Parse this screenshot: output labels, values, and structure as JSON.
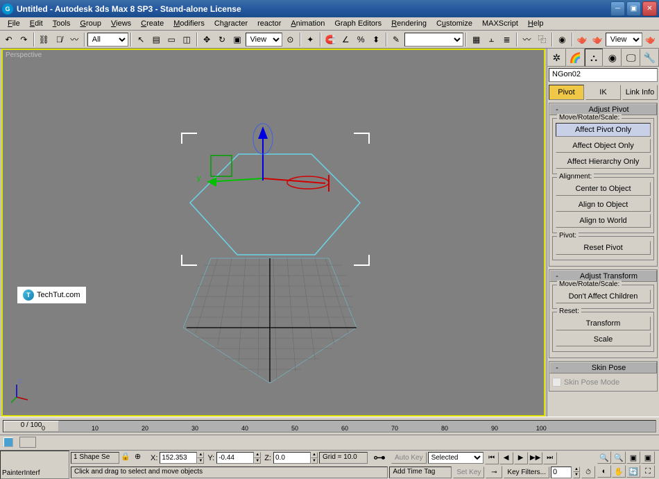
{
  "window": {
    "title": "Untitled - Autodesk 3ds Max 8 SP3  - Stand-alone License"
  },
  "menus": [
    "File",
    "Edit",
    "Tools",
    "Group",
    "Views",
    "Create",
    "Modifiers",
    "Character",
    "reactor",
    "Animation",
    "Graph Editors",
    "Rendering",
    "Customize",
    "MAXScript",
    "Help"
  ],
  "toolbar": {
    "selection_filter": "All",
    "refcoord": "View",
    "named_sel": "",
    "render_view": "View"
  },
  "viewport": {
    "label": "Perspective",
    "axis_y": "y",
    "axis_z": "z"
  },
  "watermark": {
    "text": "TechTut.com"
  },
  "cmdpanel": {
    "object_name": "NGon02",
    "subtabs": {
      "pivot": "Pivot",
      "ik": "IK",
      "link": "Link Info"
    },
    "rollout_adjust_pivot": {
      "title": "Adjust Pivot",
      "group_mrs": "Move/Rotate/Scale:",
      "btn_affect_pivot": "Affect Pivot Only",
      "btn_affect_object": "Affect Object Only",
      "btn_affect_hier": "Affect Hierarchy Only",
      "group_align": "Alignment:",
      "btn_center": "Center to Object",
      "btn_align_obj": "Align to Object",
      "btn_align_world": "Align to World",
      "group_pivot": "Pivot:",
      "btn_reset_pivot": "Reset Pivot"
    },
    "rollout_adjust_trans": {
      "title": "Adjust Transform",
      "group_mrs": "Move/Rotate/Scale:",
      "btn_dont_affect": "Don't Affect Children",
      "group_reset": "Reset:",
      "btn_transform": "Transform",
      "btn_scale": "Scale"
    },
    "rollout_skin": {
      "title": "Skin Pose",
      "chk_skin_pose": "Skin Pose Mode"
    }
  },
  "timeline": {
    "current": "0 / 100",
    "ticks": [
      0,
      10,
      20,
      30,
      40,
      50,
      60,
      70,
      80,
      90,
      100
    ]
  },
  "status": {
    "prompt": "PainterInterf",
    "shape_sel": "1 Shape Se",
    "x": "152.353",
    "y": "-0.44",
    "z": "0.0",
    "grid": "Grid = 10.0",
    "hint": "Click and drag to select and move objects",
    "time_tag": "Add Time Tag",
    "auto_key": "Auto Key",
    "set_key": "Set Key",
    "key_mode": "Selected",
    "key_filters": "Key Filters..."
  }
}
